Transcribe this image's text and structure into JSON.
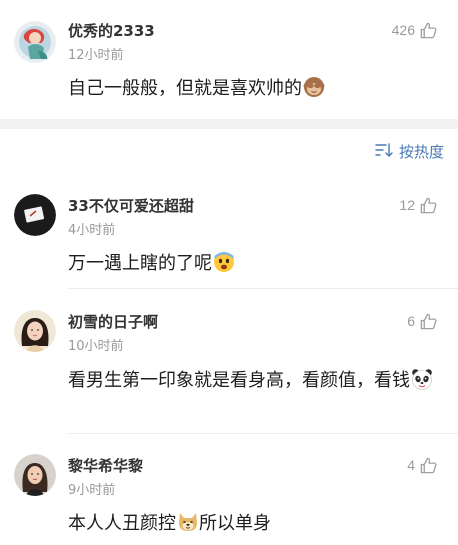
{
  "comments": [
    {
      "username": "优秀的2333",
      "time": "12小时前",
      "text": "自己一般般，但就是喜欢帅的",
      "emoji": "see-no-evil-monkey-icon",
      "likes": "426"
    },
    {
      "username": "33不仅可爱还超甜",
      "time": "4小时前",
      "text": "万一遇上瞎的了呢",
      "emoji": "fearful-face-icon",
      "likes": "12"
    },
    {
      "username": "初雪的日子啊",
      "time": "10小时前",
      "text": "看男生第一印象就是看身高，看颜值，看钱",
      "emoji": "panda-face-icon",
      "likes": "6"
    },
    {
      "username": "黎华希华黎",
      "time": "9小时前",
      "text": "本人人丑颜控",
      "text_after": "所以单身",
      "emoji": "doge-icon",
      "likes": "4"
    }
  ],
  "sort": {
    "label": "按热度",
    "icon": "sort-icon"
  },
  "colors": {
    "accent": "#4b7bb5",
    "meta": "#9a9a9a",
    "separator": "#f2f2f2"
  }
}
